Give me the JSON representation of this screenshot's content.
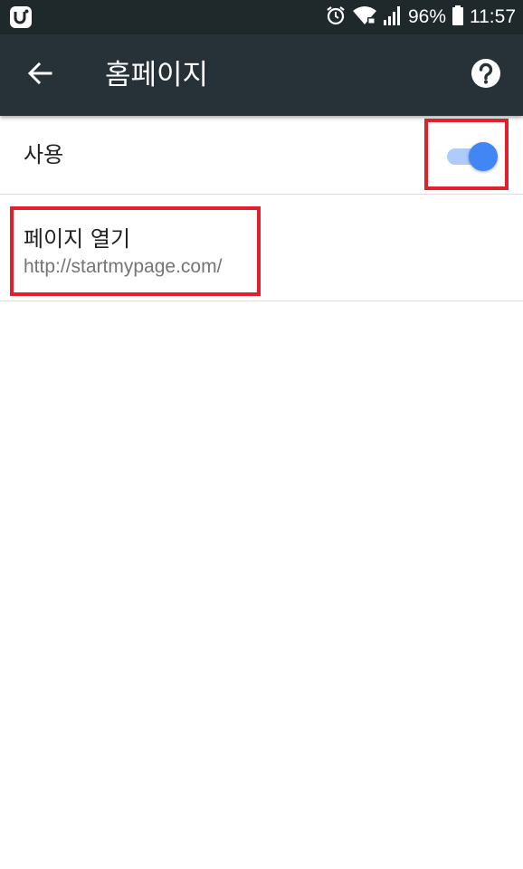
{
  "status_bar": {
    "battery_percent": "96%",
    "time": "11:57",
    "icons": [
      "uplus-icon",
      "alarm-icon",
      "wifi-icon",
      "signal-icon",
      "battery-icon"
    ]
  },
  "toolbar": {
    "title": "홈페이지",
    "back_icon": "arrow-back-icon",
    "help_icon": "help-icon"
  },
  "settings": {
    "use": {
      "label": "사용",
      "enabled": true
    },
    "open_page": {
      "title": "페이지 열기",
      "url": "http://startmypage.com/"
    }
  },
  "colors": {
    "status_bar_bg": "#1f282b",
    "toolbar_bg": "#263238",
    "switch_thumb": "#4285f4",
    "switch_track": "#aecbfa",
    "highlight": "#e0202a"
  }
}
